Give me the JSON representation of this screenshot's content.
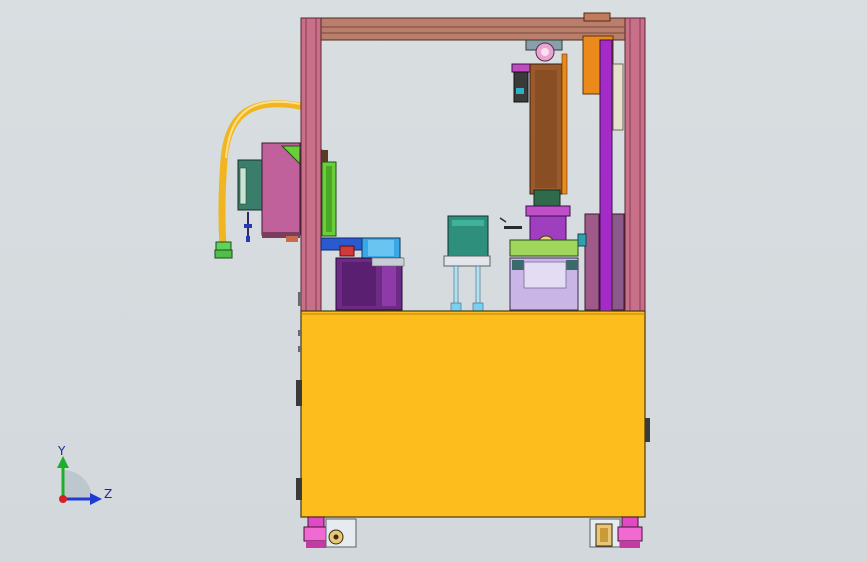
{
  "view": {
    "background": "#d7dde0"
  },
  "axes": {
    "y_label": "Y",
    "z_label": "Z",
    "y_color": "#1fae2b",
    "z_color": "#1f3bd6",
    "origin_color": "#d81f1f"
  },
  "colors": {
    "frame_post": "#c8708a",
    "frame_edge": "#5a2333",
    "top_beam": "#b97f6c",
    "cabinet": "#fdbd1c",
    "cabinet_edge": "#4a3a12",
    "hose": "#f0b520",
    "feeder_body": "#c1619b",
    "feeder_side": "#69ce3a",
    "column_purple": "#a42bc8",
    "slide_orange": "#e98a1a",
    "slide_brown": "#9a5a2c",
    "bowl_purple": "#6e2b86",
    "bowl_blue": "#3aa8e6",
    "teal_box": "#2d8f7c",
    "fixture_lilac": "#c9b6e6",
    "fixture_green": "#9fd65b",
    "caster_magenta": "#e04ac2",
    "caster_wheel": "#e8c77a"
  }
}
